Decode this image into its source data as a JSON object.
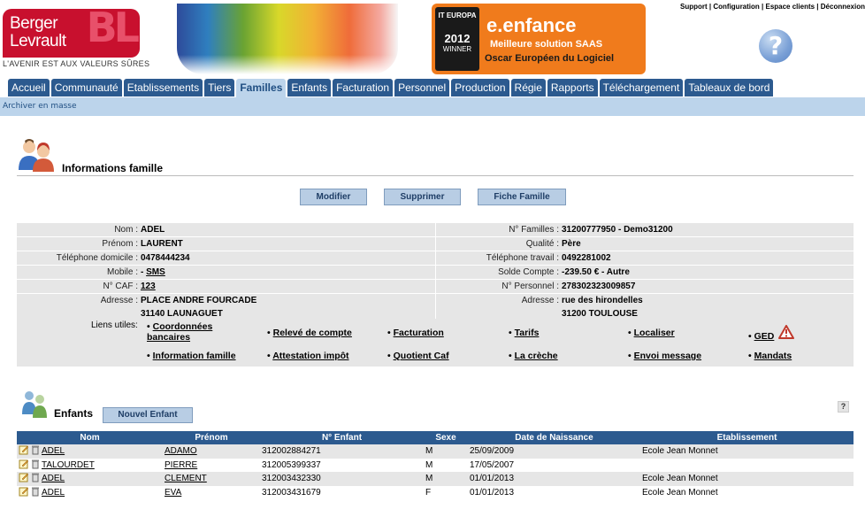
{
  "header": {
    "logo_line1": "Berger",
    "logo_line2": "Levrault",
    "logo_mark": "BL",
    "tagline": "L'AVENIR EST AUX VALEURS SÛRES",
    "award": {
      "badge_top": "IT EUROPA",
      "badge_year": "2012",
      "badge_bottom": "WINNER",
      "title": "e.enfance",
      "subtitle": "Meilleure solution SAAS",
      "caption": "Oscar Européen du Logiciel"
    },
    "links": [
      "Support",
      "Configuration",
      "Espace clients",
      "Déconnexion"
    ],
    "separator": " | ",
    "help_glyph": "?"
  },
  "nav": {
    "tabs": [
      "Accueil",
      "Communauté",
      "Etablissements",
      "Tiers",
      "Familles",
      "Enfants",
      "Facturation",
      "Personnel",
      "Production",
      "Régie",
      "Rapports",
      "Téléchargement",
      "Tableaux de bord"
    ],
    "active": "Familles"
  },
  "subnav": {
    "archive": "Archiver en masse"
  },
  "famille": {
    "title": "Informations famille",
    "buttons": {
      "modify": "Modifier",
      "delete": "Supprimer",
      "sheet": "Fiche Famille"
    },
    "rows": [
      {
        "l1": "Nom :",
        "v1": "ADEL",
        "l2": "N° Familles :",
        "v2": "31200777950 - Demo31200"
      },
      {
        "l1": "Prénom :",
        "v1": "LAURENT",
        "l2": "Qualité :",
        "v2": "Père"
      },
      {
        "l1": "Téléphone domicile :",
        "v1": "0478444234",
        "l2": "Téléphone travail :",
        "v2": "0492281002"
      },
      {
        "l1": "Mobile :",
        "v1": "-",
        "v1_link": "SMS",
        "l2": "Solde Compte :",
        "v2": "-239.50 € - Autre"
      },
      {
        "l1": "N° CAF :",
        "v1_link": "123",
        "l2": "N° Personnel :",
        "v2": "278302323009857"
      },
      {
        "l1": "Adresse :",
        "v1": "PLACE ANDRE FOURCADE",
        "v1b": "31140 LAUNAGUET",
        "l2": "Adresse :",
        "v2": "rue des hirondelles",
        "v2b": "31200 TOULOUSE"
      }
    ],
    "liens_label": "Liens utiles:",
    "liens": [
      "Coordonnées",
      "bancaires",
      "Relevé de compte",
      "Facturation",
      "Tarifs",
      "Localiser",
      "GED",
      "Information famille",
      "Attestation impôt",
      "Quotient Caf",
      "La crèche",
      "Envoi message",
      "Mandats"
    ],
    "bullet": "•"
  },
  "enfants": {
    "title": "Enfants",
    "new_button": "Nouvel Enfant",
    "help": "?",
    "headers": [
      "Nom",
      "Prénom",
      "N° Enfant",
      "Sexe",
      "Date de Naissance",
      "Etablissement"
    ],
    "rows": [
      {
        "nom": "ADEL",
        "prenom": "ADAMO",
        "num": "312002884271",
        "sexe": "M",
        "date": "25/09/2009",
        "etab": "Ecole Jean Monnet"
      },
      {
        "nom": "TALOURDET",
        "prenom": "PIERRE",
        "num": "312005399337",
        "sexe": "M",
        "date": "17/05/2007",
        "etab": ""
      },
      {
        "nom": "ADEL",
        "prenom": "CLEMENT",
        "num": "312003432330",
        "sexe": "M",
        "date": "01/01/2013",
        "etab": "Ecole Jean Monnet"
      },
      {
        "nom": "ADEL",
        "prenom": "EVA",
        "num": "312003431679",
        "sexe": "F",
        "date": "01/01/2013",
        "etab": "Ecole Jean Monnet"
      }
    ]
  }
}
